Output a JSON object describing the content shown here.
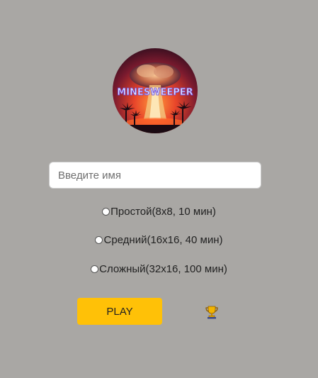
{
  "logo": {
    "text": "MINESWEEPER",
    "icon": "minesweeper-logo-icon"
  },
  "name_field": {
    "placeholder": "Введите имя",
    "value": ""
  },
  "difficulty": {
    "options": [
      {
        "label": "Простой(8x8, 10 мин)",
        "selected": false
      },
      {
        "label": "Средний(16x16, 40 мин)",
        "selected": false
      },
      {
        "label": "Сложный(32x16, 100 мин)",
        "selected": false
      }
    ]
  },
  "play_button": {
    "label": "PLAY",
    "color": "#ffc107"
  },
  "leaderboard": {
    "icon": "trophy-icon"
  },
  "colors": {
    "background": "#a9a7a4",
    "accent": "#ffc107"
  }
}
